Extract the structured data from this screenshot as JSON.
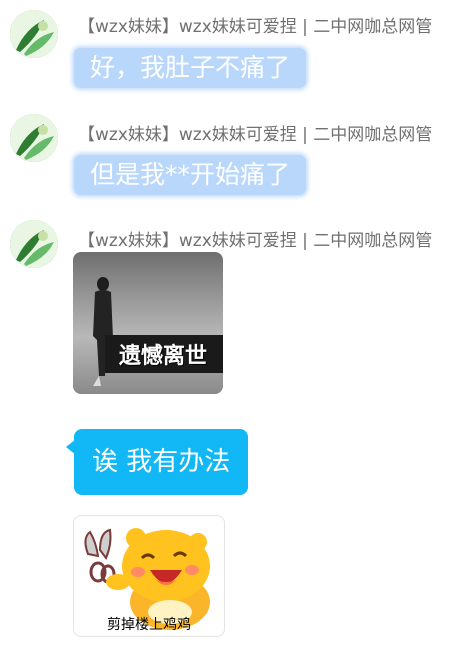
{
  "messages": [
    {
      "sender": "【wzx妹妹】wzx妹妹可爱捏 | 二中网咖总网管",
      "text": "好，我肚子不痛了"
    },
    {
      "sender": "【wzx妹妹】wzx妹妹可爱捏 | 二中网咖总网管",
      "text": "但是我**开始痛了"
    },
    {
      "sender": "【wzx妹妹】wzx妹妹可爱捏 | 二中网咖总网管",
      "sticker_caption": "遗憾离世"
    }
  ],
  "reply": {
    "text": "诶 我有办法"
  },
  "reply_sticker": {
    "caption": "剪掉楼上鸡鸡"
  },
  "colors": {
    "plain_bubble": "#b9d7fa",
    "blue_bubble": "#12b7f5",
    "sender_text": "#707070"
  },
  "icons": {
    "avatar": "green-plant-avatar",
    "sticker_figure": "walking-figure",
    "sticker_mascot": "qq-penguin-with-scissors"
  }
}
